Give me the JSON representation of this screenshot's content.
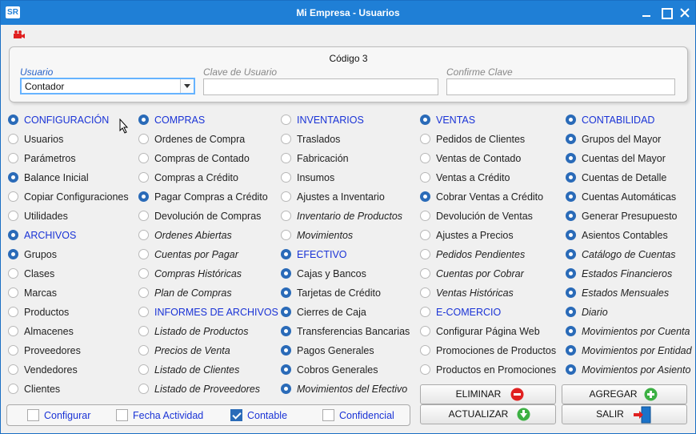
{
  "window": {
    "title": "Mi Empresa - Usuarios",
    "logo_text": "SR"
  },
  "form": {
    "codigo": "Código 3",
    "usuario_label": "Usuario",
    "usuario_value": "Contador",
    "clave_label": "Clave de Usuario",
    "clave_value": "",
    "confirme_label": "Confirme Clave",
    "confirme_value": ""
  },
  "columns": [
    [
      {
        "label": "CONFIGURACIÓN",
        "checked": true,
        "header": true,
        "italic": false
      },
      {
        "label": "Usuarios",
        "checked": false,
        "header": false,
        "italic": false
      },
      {
        "label": "Parámetros",
        "checked": false,
        "header": false,
        "italic": false
      },
      {
        "label": "Balance Inicial",
        "checked": true,
        "header": false,
        "italic": false
      },
      {
        "label": "Copiar Configuraciones",
        "checked": false,
        "header": false,
        "italic": false
      },
      {
        "label": "Utilidades",
        "checked": false,
        "header": false,
        "italic": false
      },
      {
        "label": "ARCHIVOS",
        "checked": true,
        "header": true,
        "italic": false
      },
      {
        "label": "Grupos",
        "checked": true,
        "header": false,
        "italic": false
      },
      {
        "label": "Clases",
        "checked": false,
        "header": false,
        "italic": false
      },
      {
        "label": "Marcas",
        "checked": false,
        "header": false,
        "italic": false
      },
      {
        "label": "Productos",
        "checked": false,
        "header": false,
        "italic": false
      },
      {
        "label": "Almacenes",
        "checked": false,
        "header": false,
        "italic": false
      },
      {
        "label": "Proveedores",
        "checked": false,
        "header": false,
        "italic": false
      },
      {
        "label": "Vendedores",
        "checked": false,
        "header": false,
        "italic": false
      },
      {
        "label": "Clientes",
        "checked": false,
        "header": false,
        "italic": false
      }
    ],
    [
      {
        "label": "COMPRAS",
        "checked": true,
        "header": true,
        "italic": false
      },
      {
        "label": "Ordenes de Compra",
        "checked": false,
        "header": false,
        "italic": false
      },
      {
        "label": "Compras de Contado",
        "checked": false,
        "header": false,
        "italic": false
      },
      {
        "label": "Compras a Crédito",
        "checked": false,
        "header": false,
        "italic": false
      },
      {
        "label": "Pagar Compras a Crédito",
        "checked": true,
        "header": false,
        "italic": false
      },
      {
        "label": "Devolución de Compras",
        "checked": false,
        "header": false,
        "italic": false
      },
      {
        "label": "Ordenes Abiertas",
        "checked": false,
        "header": false,
        "italic": true
      },
      {
        "label": "Cuentas por Pagar",
        "checked": false,
        "header": false,
        "italic": true
      },
      {
        "label": "Compras Históricas",
        "checked": false,
        "header": false,
        "italic": true
      },
      {
        "label": "Plan de Compras",
        "checked": false,
        "header": false,
        "italic": true
      },
      {
        "label": "INFORMES DE ARCHIVOS",
        "checked": false,
        "header": true,
        "italic": false
      },
      {
        "label": "Listado de Productos",
        "checked": false,
        "header": false,
        "italic": true
      },
      {
        "label": "Precios de Venta",
        "checked": false,
        "header": false,
        "italic": true
      },
      {
        "label": "Listado de Clientes",
        "checked": false,
        "header": false,
        "italic": true
      },
      {
        "label": "Listado de Proveedores",
        "checked": false,
        "header": false,
        "italic": true
      }
    ],
    [
      {
        "label": "INVENTARIOS",
        "checked": false,
        "header": true,
        "italic": false
      },
      {
        "label": "Traslados",
        "checked": false,
        "header": false,
        "italic": false
      },
      {
        "label": "Fabricación",
        "checked": false,
        "header": false,
        "italic": false
      },
      {
        "label": "Insumos",
        "checked": false,
        "header": false,
        "italic": false
      },
      {
        "label": "Ajustes a Inventario",
        "checked": false,
        "header": false,
        "italic": false
      },
      {
        "label": "Inventario de Productos",
        "checked": false,
        "header": false,
        "italic": true
      },
      {
        "label": "Movimientos",
        "checked": false,
        "header": false,
        "italic": true
      },
      {
        "label": "EFECTIVO",
        "checked": true,
        "header": true,
        "italic": false
      },
      {
        "label": "Cajas y Bancos",
        "checked": true,
        "header": false,
        "italic": false
      },
      {
        "label": "Tarjetas de Crédito",
        "checked": true,
        "header": false,
        "italic": false
      },
      {
        "label": "Cierres de Caja",
        "checked": true,
        "header": false,
        "italic": false
      },
      {
        "label": "Transferencias Bancarias",
        "checked": true,
        "header": false,
        "italic": false
      },
      {
        "label": "Pagos Generales",
        "checked": true,
        "header": false,
        "italic": false
      },
      {
        "label": "Cobros Generales",
        "checked": true,
        "header": false,
        "italic": false
      },
      {
        "label": "Movimientos del Efectivo",
        "checked": true,
        "header": false,
        "italic": true
      }
    ],
    [
      {
        "label": "VENTAS",
        "checked": true,
        "header": true,
        "italic": false
      },
      {
        "label": "Pedidos de Clientes",
        "checked": false,
        "header": false,
        "italic": false
      },
      {
        "label": "Ventas de Contado",
        "checked": false,
        "header": false,
        "italic": false
      },
      {
        "label": "Ventas a Crédito",
        "checked": false,
        "header": false,
        "italic": false
      },
      {
        "label": "Cobrar Ventas a Crédito",
        "checked": true,
        "header": false,
        "italic": false
      },
      {
        "label": "Devolución de Ventas",
        "checked": false,
        "header": false,
        "italic": false
      },
      {
        "label": "Ajustes a Precios",
        "checked": false,
        "header": false,
        "italic": false
      },
      {
        "label": "Pedidos Pendientes",
        "checked": false,
        "header": false,
        "italic": true
      },
      {
        "label": "Cuentas por Cobrar",
        "checked": false,
        "header": false,
        "italic": true
      },
      {
        "label": "Ventas Históricas",
        "checked": false,
        "header": false,
        "italic": true
      },
      {
        "label": "E-COMERCIO",
        "checked": false,
        "header": true,
        "italic": false
      },
      {
        "label": "Configurar Página Web",
        "checked": false,
        "header": false,
        "italic": false
      },
      {
        "label": "Promociones de Productos",
        "checked": false,
        "header": false,
        "italic": false
      },
      {
        "label": "Productos en Promociones",
        "checked": false,
        "header": false,
        "italic": false
      }
    ],
    [
      {
        "label": "CONTABILIDAD",
        "checked": true,
        "header": true,
        "italic": false
      },
      {
        "label": "Grupos del Mayor",
        "checked": true,
        "header": false,
        "italic": false
      },
      {
        "label": "Cuentas del Mayor",
        "checked": true,
        "header": false,
        "italic": false
      },
      {
        "label": "Cuentas de Detalle",
        "checked": true,
        "header": false,
        "italic": false
      },
      {
        "label": "Cuentas Automáticas",
        "checked": true,
        "header": false,
        "italic": false
      },
      {
        "label": "Generar Presupuesto",
        "checked": true,
        "header": false,
        "italic": false
      },
      {
        "label": "Asientos Contables",
        "checked": true,
        "header": false,
        "italic": false
      },
      {
        "label": "Catálogo de Cuentas",
        "checked": true,
        "header": false,
        "italic": true
      },
      {
        "label": "Estados Financieros",
        "checked": true,
        "header": false,
        "italic": true
      },
      {
        "label": "Estados Mensuales",
        "checked": true,
        "header": false,
        "italic": true
      },
      {
        "label": "Diario",
        "checked": true,
        "header": false,
        "italic": true
      },
      {
        "label": "Movimientos por Cuenta",
        "checked": true,
        "header": false,
        "italic": true
      },
      {
        "label": "Movimientos por Entidad",
        "checked": true,
        "header": false,
        "italic": true
      },
      {
        "label": "Movimientos por Asiento",
        "checked": true,
        "header": false,
        "italic": true
      }
    ]
  ],
  "options": [
    {
      "label": "Configurar",
      "checked": false
    },
    {
      "label": "Fecha Actividad",
      "checked": false
    },
    {
      "label": "Contable",
      "checked": true
    },
    {
      "label": "Confidencial",
      "checked": false
    }
  ],
  "buttons": {
    "eliminar": "ELIMINAR",
    "agregar": "AGREGAR",
    "actualizar": "ACTUALIZAR",
    "salir": "SALIR"
  },
  "icons": {
    "camera": "camera-icon",
    "eliminar": "minus-circle-icon",
    "agregar": "plus-circle-icon",
    "actualizar": "down-arrow-circle-icon",
    "salir": "exit-door-icon"
  },
  "colors": {
    "titlebar": "#1f7fd6",
    "header_text": "#1a33d6",
    "radio_on": "#2a6bb8",
    "eliminar_icon": "#e02020",
    "agregar_icon": "#3cb043"
  }
}
